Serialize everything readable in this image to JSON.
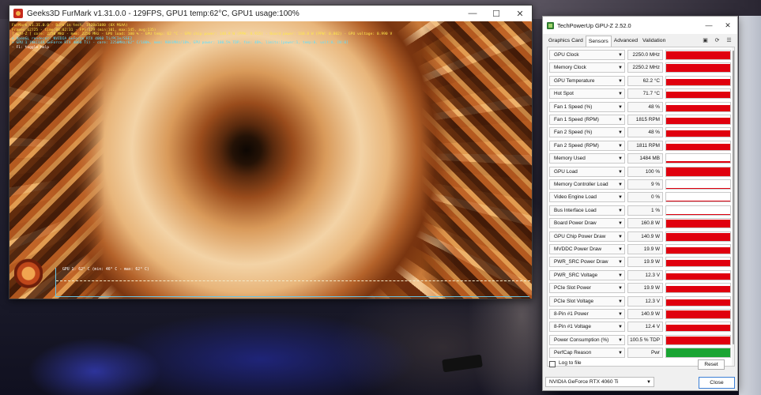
{
  "furmark": {
    "title": "Geeks3D FurMark v1.31.0.0 - 129FPS, GPU1 temp:62°C, GPU1 usage:100%",
    "hud_lines": [
      {
        "text": "FurMark v1.31.0.0 - Burn-in test, 1920x1080 (8X MSAA)",
        "tone": "yellow"
      },
      {
        "text": "Frames:62725 - time:08:02:31 - FPS:129 (min:101, max:145, avg:135)",
        "tone": "yellow"
      },
      {
        "text": "[ GPU-Z ] core: 2250 MHz - mem: 2250 MHz - GPU load: 100 % - GPU temp: 62 °C - GPU chip power: 140.9 W (PPW: 0.915) - Board power: 160.8 W (PPW: 0.802) - GPU voltage: 0.990 V",
        "tone": "yellow"
      },
      {
        "text": "> OpenGL renderer: NVIDIA GeForce RTX 4060 Ti/PCIe/SSE2",
        "tone": "cyan"
      },
      {
        "text": "> GPU 1 (NVIDIA GeForce RTX 4060 Ti) - core: 2250MHz/62° C/100%, mem: 9001MHz/18%, GPU power: 100.5% TDP, fan: 48%, limits:[power:1, temp:0, volt:0, OV:0]",
        "tone": "cyan"
      },
      {
        "text": "- F1: toggle help",
        "tone": "white"
      }
    ],
    "graph_label": "GPU 1: 62° C (min: 46° C - max: 62° C)"
  },
  "gpuz": {
    "title": "TechPowerUp GPU-Z 2.52.0",
    "tabs": [
      "Graphics Card",
      "Sensors",
      "Advanced",
      "Validation"
    ],
    "active_tab": "Sensors",
    "rows": [
      {
        "name": "GPU Clock",
        "value": "2250.0 MHz",
        "fill": 0.9,
        "color": "#e0000e"
      },
      {
        "name": "Memory Clock",
        "value": "2250.2 MHz",
        "fill": 0.9,
        "color": "#e0000e"
      },
      {
        "name": "GPU Temperature",
        "value": "62.2 °C",
        "fill": 0.75,
        "color": "#e0000e"
      },
      {
        "name": "Hot Spot",
        "value": "71.7 °C",
        "fill": 0.75,
        "color": "#e0000e"
      },
      {
        "name": "Fan 1 Speed (%)",
        "value": "48 %",
        "fill": 0.7,
        "color": "#e0000e"
      },
      {
        "name": "Fan 1 Speed (RPM)",
        "value": "1815 RPM",
        "fill": 0.7,
        "color": "#e0000e"
      },
      {
        "name": "Fan 2 Speed (%)",
        "value": "48 %",
        "fill": 0.7,
        "color": "#e0000e"
      },
      {
        "name": "Fan 2 Speed (RPM)",
        "value": "1811 RPM",
        "fill": 0.7,
        "color": "#e0000e"
      },
      {
        "name": "Memory Used",
        "value": "1484 MB",
        "fill": 0.2,
        "color": "#e0000e"
      },
      {
        "name": "GPU Load",
        "value": "100 %",
        "fill": 1.0,
        "color": "#e0000e"
      },
      {
        "name": "Memory Controller Load",
        "value": "9 %",
        "fill": 0.1,
        "color": "#e0000e"
      },
      {
        "name": "Video Engine Load",
        "value": "0 %",
        "fill": 0.0,
        "color": "#e0000e"
      },
      {
        "name": "Bus Interface Load",
        "value": "1 %",
        "fill": 0.03,
        "color": "#e0000e"
      },
      {
        "name": "Board Power Draw",
        "value": "160.8 W",
        "fill": 0.88,
        "color": "#e0000e"
      },
      {
        "name": "GPU Chip Power Draw",
        "value": "140.9 W",
        "fill": 0.88,
        "color": "#e0000e"
      },
      {
        "name": "MVDDC Power Draw",
        "value": "19.9 W",
        "fill": 0.75,
        "color": "#e0000e"
      },
      {
        "name": "PWR_SRC Power Draw",
        "value": "19.9 W",
        "fill": 0.75,
        "color": "#e0000e"
      },
      {
        "name": "PWR_SRC Voltage",
        "value": "12.3 V",
        "fill": 0.75,
        "color": "#e0000e"
      },
      {
        "name": "PCIe Slot Power",
        "value": "19.9 W",
        "fill": 0.75,
        "color": "#e0000e"
      },
      {
        "name": "PCIe Slot Voltage",
        "value": "12.3 V",
        "fill": 0.75,
        "color": "#e0000e"
      },
      {
        "name": "8-Pin #1 Power",
        "value": "140.9 W",
        "fill": 0.88,
        "color": "#e0000e"
      },
      {
        "name": "8-Pin #1 Voltage",
        "value": "12.4 V",
        "fill": 0.75,
        "color": "#e0000e"
      },
      {
        "name": "Power Consumption (%)",
        "value": "100.5 % TDP",
        "fill": 0.88,
        "color": "#e0000e"
      },
      {
        "name": "PerfCap Reason",
        "value": "Pwr",
        "fill": 1.0,
        "color": "#1aa533"
      }
    ],
    "log_to_file_label": "Log to file",
    "log_to_file_checked": false,
    "reset_label": "Reset",
    "gpu_select": "NVIDIA GeForce RTX 4060 Ti",
    "close_label": "Close"
  }
}
